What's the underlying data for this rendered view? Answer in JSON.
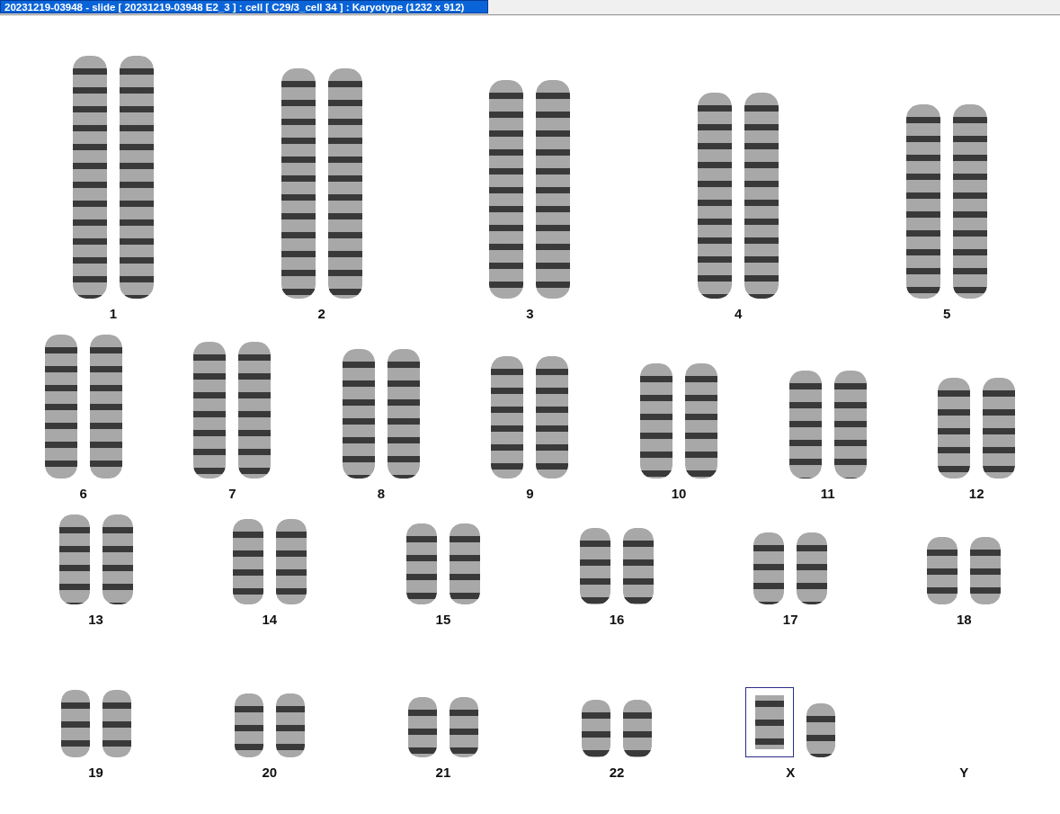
{
  "window": {
    "title": "20231219-03948 - slide [ 20231219-03948 E2_3 ] : cell [ C29/3_cell 34 ] : Karyotype  (1232 x 912)"
  },
  "rows": [
    {
      "pairs": [
        {
          "label": "1",
          "chromosomes": [
            {
              "selected": false
            },
            {
              "selected": false
            }
          ]
        },
        {
          "label": "2",
          "chromosomes": [
            {
              "selected": false
            },
            {
              "selected": false
            }
          ]
        },
        {
          "label": "3",
          "chromosomes": [
            {
              "selected": false
            },
            {
              "selected": false
            }
          ]
        },
        {
          "label": "4",
          "chromosomes": [
            {
              "selected": false
            },
            {
              "selected": false
            }
          ]
        },
        {
          "label": "5",
          "chromosomes": [
            {
              "selected": false
            },
            {
              "selected": false
            }
          ]
        }
      ]
    },
    {
      "pairs": [
        {
          "label": "6",
          "chromosomes": [
            {
              "selected": false
            },
            {
              "selected": false
            }
          ]
        },
        {
          "label": "7",
          "chromosomes": [
            {
              "selected": false
            },
            {
              "selected": false
            }
          ]
        },
        {
          "label": "8",
          "chromosomes": [
            {
              "selected": false
            },
            {
              "selected": false
            }
          ]
        },
        {
          "label": "9",
          "chromosomes": [
            {
              "selected": false
            },
            {
              "selected": false
            }
          ]
        },
        {
          "label": "10",
          "chromosomes": [
            {
              "selected": false
            },
            {
              "selected": false
            }
          ]
        },
        {
          "label": "11",
          "chromosomes": [
            {
              "selected": false
            },
            {
              "selected": false
            }
          ]
        },
        {
          "label": "12",
          "chromosomes": [
            {
              "selected": false
            },
            {
              "selected": false
            }
          ]
        }
      ]
    },
    {
      "pairs": [
        {
          "label": "13",
          "chromosomes": [
            {
              "selected": false
            },
            {
              "selected": false
            }
          ]
        },
        {
          "label": "14",
          "chromosomes": [
            {
              "selected": false
            },
            {
              "selected": false
            }
          ]
        },
        {
          "label": "15",
          "chromosomes": [
            {
              "selected": false
            },
            {
              "selected": false
            }
          ]
        },
        {
          "label": "16",
          "chromosomes": [
            {
              "selected": false
            },
            {
              "selected": false
            }
          ]
        },
        {
          "label": "17",
          "chromosomes": [
            {
              "selected": false
            },
            {
              "selected": false
            }
          ]
        },
        {
          "label": "18",
          "chromosomes": [
            {
              "selected": false
            },
            {
              "selected": false
            }
          ]
        }
      ]
    },
    {
      "pairs": [
        {
          "label": "19",
          "chromosomes": [
            {
              "selected": false
            },
            {
              "selected": false
            }
          ]
        },
        {
          "label": "20",
          "chromosomes": [
            {
              "selected": false
            },
            {
              "selected": false
            }
          ]
        },
        {
          "label": "21",
          "chromosomes": [
            {
              "selected": false
            },
            {
              "selected": false
            }
          ]
        },
        {
          "label": "22",
          "chromosomes": [
            {
              "selected": false
            },
            {
              "selected": false
            }
          ]
        },
        {
          "label": "X",
          "chromosomes": [
            {
              "selected": true
            },
            {
              "selected": false
            }
          ]
        },
        {
          "label": "Y"
        }
      ]
    }
  ]
}
